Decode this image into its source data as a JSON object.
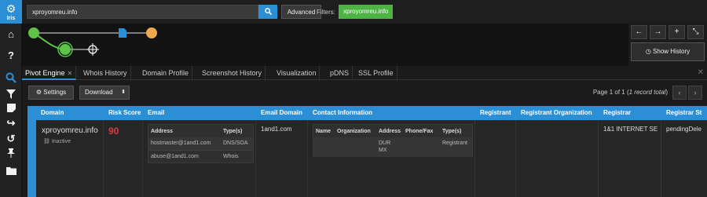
{
  "app": {
    "logo_text": "Iris"
  },
  "search": {
    "query": "xproyomreu.info",
    "advanced_label": "Advanced"
  },
  "filters": {
    "label": "Filters:",
    "active": "xproyomreu.info"
  },
  "history": {
    "show_label": "Show History"
  },
  "tabs": [
    {
      "label": "Pivot Engine"
    },
    {
      "label": "Whois History"
    },
    {
      "label": "Domain Profile"
    },
    {
      "label": "Screenshot History"
    },
    {
      "label": "Visualization"
    },
    {
      "label": "pDNS"
    },
    {
      "label": "SSL Profile"
    }
  ],
  "toolbar": {
    "settings_label": "Settings",
    "download_label": "Download",
    "paging_prefix": "Page 1 of 1 (",
    "paging_italic": "1 record total",
    "paging_suffix": ")"
  },
  "table": {
    "headers": [
      "Domain",
      "Risk Score",
      "Email",
      "Email Domain",
      "Contact Information",
      "Registrant",
      "Registrant Organization",
      "Registrar",
      "Registrar St"
    ],
    "row": {
      "domain": "xproyomreu.info",
      "status": "Inactive",
      "risk_score": "90",
      "email_domain": "1and1.com",
      "registrar": "1&1 INTERNET SE",
      "registrar_status": "pendingDele"
    },
    "email_sub": {
      "headers": [
        "Address",
        "Type(s)"
      ],
      "rows": [
        {
          "address": "hostmaster@1and1.com",
          "type": "DNS/SOA"
        },
        {
          "address": "abuse@1and1.com",
          "type": "Whois"
        }
      ]
    },
    "contact_sub": {
      "headers": [
        "Name",
        "Organization",
        "Address",
        "Phone/Fax",
        "Type(s)"
      ],
      "address_lines": [
        "DUR",
        "MX"
      ],
      "type": "Registrant"
    }
  },
  "colors": {
    "accent": "#2c8fd6",
    "filter_green": "#4bb443",
    "risk_red": "#e0393e",
    "graph_green": "#5cc446",
    "graph_orange": "#f0a84a"
  }
}
